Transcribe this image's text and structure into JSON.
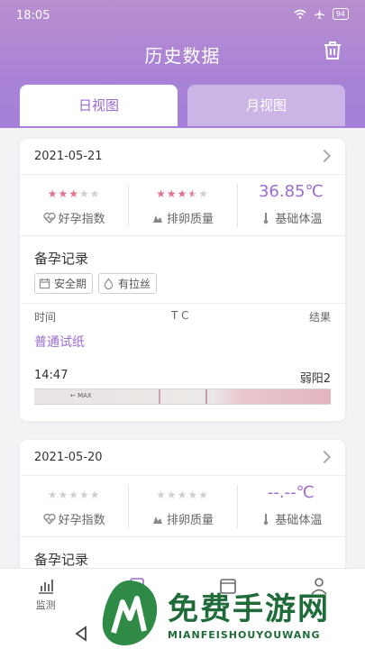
{
  "status_bar": {
    "time": "18:05",
    "battery": "94"
  },
  "header": {
    "title": "历史数据"
  },
  "tabs": [
    {
      "label": "日视图",
      "active": true
    },
    {
      "label": "月视图",
      "active": false
    }
  ],
  "records": [
    {
      "date": "2021-05-21",
      "pregnancy_index": {
        "stars": 3,
        "label": "好孕指数"
      },
      "ovulation_quality": {
        "stars": 3.5,
        "label": "排卵质量"
      },
      "basal_temp": {
        "value": "36.85℃",
        "label": "基础体温"
      },
      "record_title": "备孕记录",
      "chips": [
        "安全期",
        "有拉丝"
      ],
      "table_headers": {
        "time": "时间",
        "tc": "T C",
        "result": "结果"
      },
      "paper_type": "普通试纸",
      "result_time": "14:47",
      "result_value": "弱阳2",
      "strip_max_label": "← MAX"
    },
    {
      "date": "2021-05-20",
      "pregnancy_index": {
        "stars": 0,
        "label": "好孕指数"
      },
      "ovulation_quality": {
        "stars": 0,
        "label": "排卵质量"
      },
      "basal_temp": {
        "value": "--.--℃",
        "label": "基础体温"
      },
      "record_title": "备孕记录"
    }
  ],
  "bottom_nav": [
    {
      "label": "监测",
      "icon": "chart-icon"
    },
    {
      "label": "",
      "icon": "record-icon"
    },
    {
      "label": "",
      "icon": "calendar-icon"
    },
    {
      "label": "",
      "icon": "profile-icon"
    }
  ],
  "watermark": {
    "text": "免费手游网",
    "sub": "MIANFEISHOUYOUWANG"
  },
  "colors": {
    "accent": "#9a6bd0",
    "header": "#a982d6",
    "star": "#e0728b"
  }
}
